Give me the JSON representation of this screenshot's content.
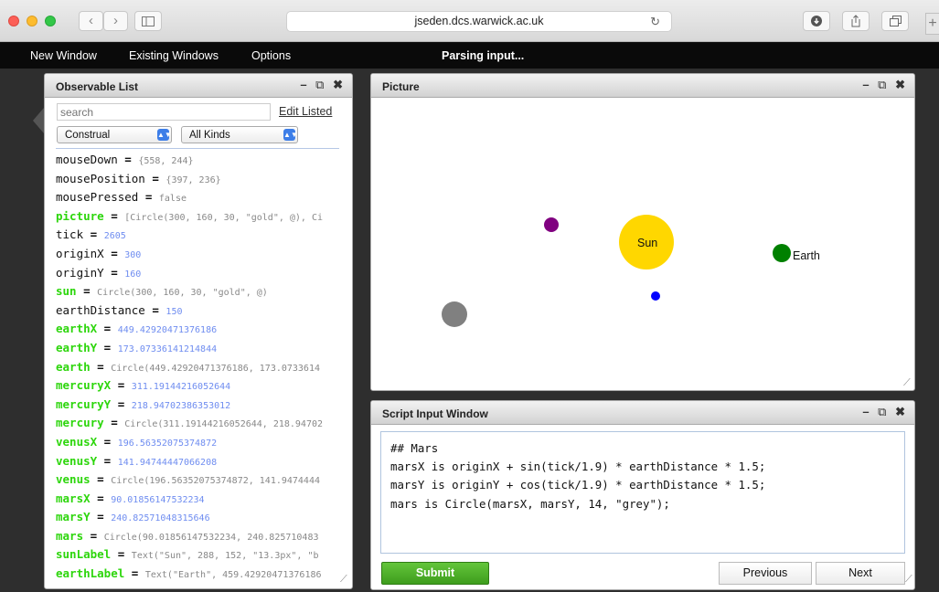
{
  "browser": {
    "url": "jseden.dcs.warwick.ac.uk",
    "reload_icon": "↻",
    "download_icon": "download-icon",
    "share_icon": "share-icon",
    "tabs_icon": "tabs-icon",
    "new_tab_glyph": "+"
  },
  "menubar": {
    "items": [
      "New Window",
      "Existing Windows",
      "Options"
    ],
    "status": "Parsing input..."
  },
  "observable_list": {
    "title": "Observable List",
    "search_placeholder": "search",
    "edit_listed": "Edit Listed",
    "construal_select": "Construal",
    "kinds_select": "All Kinds",
    "rows": [
      {
        "name": "mouseDown",
        "value": "{558, 244}",
        "name_style": "black",
        "value_style": "grey"
      },
      {
        "name": "mousePosition",
        "value": "{397, 236}",
        "name_style": "black",
        "value_style": "grey"
      },
      {
        "name": "mousePressed",
        "value": "false",
        "name_style": "black",
        "value_style": "grey"
      },
      {
        "name": "picture",
        "value": "[Circle(300, 160, 30, \"gold\", @), Ci",
        "name_style": "green",
        "value_style": "grey"
      },
      {
        "name": "tick",
        "value": "2605",
        "name_style": "black",
        "value_style": "blue"
      },
      {
        "name": "originX",
        "value": "300",
        "name_style": "black",
        "value_style": "blue"
      },
      {
        "name": "originY",
        "value": "160",
        "name_style": "black",
        "value_style": "blue"
      },
      {
        "name": "sun",
        "value": "Circle(300, 160, 30, \"gold\", @)",
        "name_style": "green",
        "value_style": "grey"
      },
      {
        "name": "earthDistance",
        "value": "150",
        "name_style": "black",
        "value_style": "blue"
      },
      {
        "name": "earthX",
        "value": "449.42920471376186",
        "name_style": "green",
        "value_style": "blue"
      },
      {
        "name": "earthY",
        "value": "173.07336141214844",
        "name_style": "green",
        "value_style": "blue"
      },
      {
        "name": "earth",
        "value": "Circle(449.42920471376186, 173.0733614",
        "name_style": "green",
        "value_style": "grey"
      },
      {
        "name": "mercuryX",
        "value": "311.19144216052644",
        "name_style": "green",
        "value_style": "blue"
      },
      {
        "name": "mercuryY",
        "value": "218.94702386353012",
        "name_style": "green",
        "value_style": "blue"
      },
      {
        "name": "mercury",
        "value": "Circle(311.19144216052644, 218.94702",
        "name_style": "green",
        "value_style": "grey"
      },
      {
        "name": "venusX",
        "value": "196.56352075374872",
        "name_style": "green",
        "value_style": "blue"
      },
      {
        "name": "venusY",
        "value": "141.94744447066208",
        "name_style": "green",
        "value_style": "blue"
      },
      {
        "name": "venus",
        "value": "Circle(196.56352075374872, 141.9474444",
        "name_style": "green",
        "value_style": "grey"
      },
      {
        "name": "marsX",
        "value": "90.01856147532234",
        "name_style": "green",
        "value_style": "blue"
      },
      {
        "name": "marsY",
        "value": "240.82571048315646",
        "name_style": "green",
        "value_style": "blue"
      },
      {
        "name": "mars",
        "value": "Circle(90.01856147532234, 240.825710483",
        "name_style": "green",
        "value_style": "grey"
      },
      {
        "name": "sunLabel",
        "value": "Text(\"Sun\", 288, 152, \"13.3px\", \"b",
        "name_style": "green",
        "value_style": "grey"
      },
      {
        "name": "earthLabel",
        "value": "Text(\"Earth\", 459.42920471376186",
        "name_style": "green",
        "value_style": "grey"
      }
    ]
  },
  "picture": {
    "title": "Picture",
    "sun_label": "Sun",
    "earth_label": "Earth",
    "colors": {
      "sun": "#ffd700",
      "earth": "#008000",
      "venus": "#800080",
      "mercury": "#0000ff",
      "mars": "#808080"
    }
  },
  "script": {
    "title": "Script Input Window",
    "code": "## Mars\nmarsX is originX + sin(tick/1.9) * earthDistance * 1.5;\nmarsY is originY + cos(tick/1.9) * earthDistance * 1.5;\nmars is Circle(marsX, marsY, 14, \"grey\");",
    "submit": "Submit",
    "previous": "Previous",
    "next": "Next"
  },
  "panel_controls": {
    "minimize": "–",
    "popout": "⧉",
    "close": "✖"
  }
}
